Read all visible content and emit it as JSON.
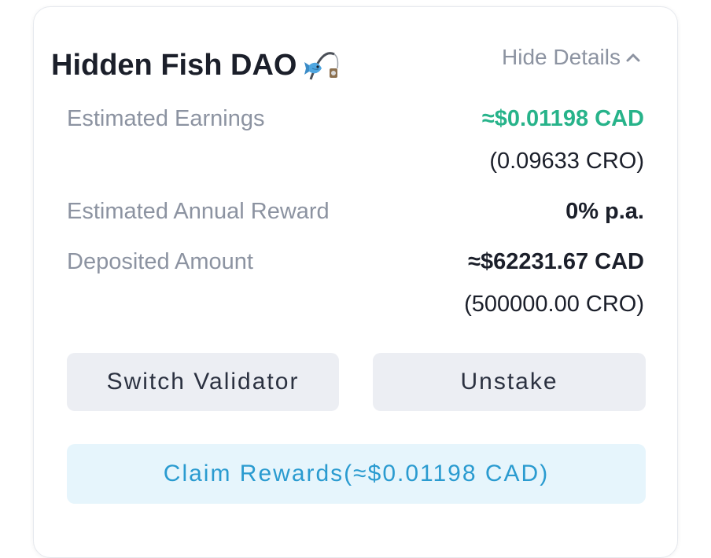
{
  "header": {
    "title": "Hidden Fish DAO",
    "title_icon": "fishing-pole-icon",
    "toggle_label": "Hide Details",
    "toggle_icon": "chevron-up-icon"
  },
  "details": {
    "earnings": {
      "label": "Estimated Earnings",
      "value": "≈$0.01198 CAD",
      "sub": "(0.09633 CRO)"
    },
    "annual": {
      "label": "Estimated Annual Reward",
      "value": "0% p.a."
    },
    "deposited": {
      "label": "Deposited Amount",
      "value": "≈$62231.67 CAD",
      "sub": "(500000.00 CRO)"
    }
  },
  "actions": {
    "switch_label": "Switch Validator",
    "unstake_label": "Unstake",
    "claim_label": "Claim Rewards(≈$0.01198 CAD)"
  },
  "colors": {
    "accent_green": "#27b38a",
    "accent_blue": "#2a9bd0",
    "muted_text": "#8c93a1"
  }
}
